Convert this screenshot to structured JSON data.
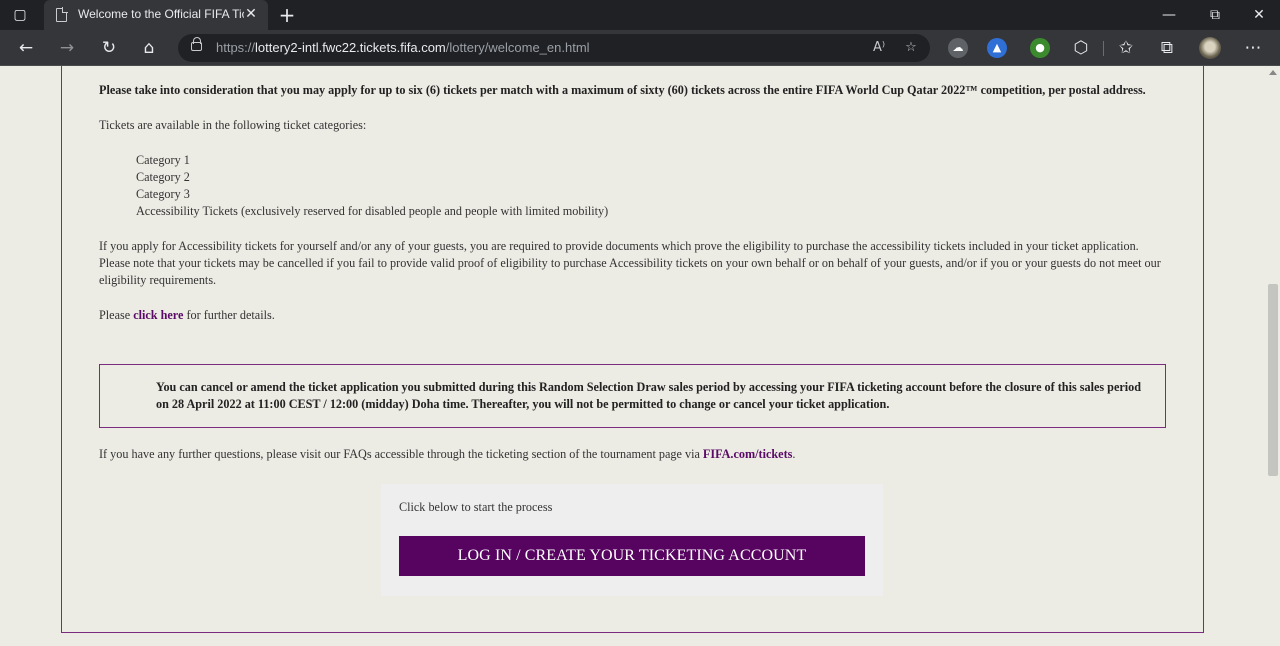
{
  "browser": {
    "tab_title": "Welcome to the Official FIFA Tick",
    "tab_close_glyph": "✕",
    "new_tab_glyph": "+",
    "url": {
      "scheme": "https://",
      "host": "lottery2-intl.fwc22.tickets.fifa.com",
      "path": "/lottery/welcome_en.html"
    },
    "read_aloud_glyph": "A⁾",
    "window_controls": {
      "minimize": "—",
      "restore": "⧉",
      "close": "✕"
    },
    "nav_glyphs": {
      "back": "←",
      "forward": "→",
      "refresh": "↻",
      "home": "⌂"
    },
    "menu_glyph": "⋯"
  },
  "content": {
    "limit_notice": "Please take into consideration that you may apply for up to six (6) tickets per match with a maximum of sixty (60) tickets across the entire FIFA World Cup Qatar 2022™ competition, per postal address.",
    "categories_intro": "Tickets are available in the following ticket categories:",
    "categories": [
      "Category 1",
      "Category 2",
      "Category 3",
      "Accessibility Tickets (exclusively reserved for disabled people and people with limited mobility)"
    ],
    "accessibility_text": "If you apply for Accessibility tickets for yourself and/or any of your guests, you are required to provide documents which prove the eligibility to purchase the accessibility tickets included in your ticket application. Please note that your tickets may be cancelled if you fail to provide valid proof of eligibility to purchase Accessibility tickets on your own behalf or on behalf of your guests, and/or if you or your guests do not meet our eligibility requirements.",
    "details_prefix": "Please ",
    "details_link": "click here",
    "details_suffix": " for further details.",
    "cancel_notice": "You can cancel or amend the ticket application you submitted during this Random Selection Draw sales period by accessing your FIFA ticketing account before the closure of this sales period on 28 April 2022 at 11:00 CEST / 12:00 (midday) Doha time. Thereafter, you will not be permitted to change or cancel your ticket application.",
    "questions_prefix": "If you have any further questions, please visit our FAQs accessible through the ticketing section of the tournament page via ",
    "questions_link": "FIFA.com/tickets",
    "questions_suffix": ".",
    "cta_label": "Click below to start the process",
    "cta_button": "LOG IN / CREATE YOUR TICKETING ACCOUNT"
  },
  "colors": {
    "accent": "#56045f",
    "frame_border": "#7b2b80",
    "page_background": "#ecebe4"
  }
}
